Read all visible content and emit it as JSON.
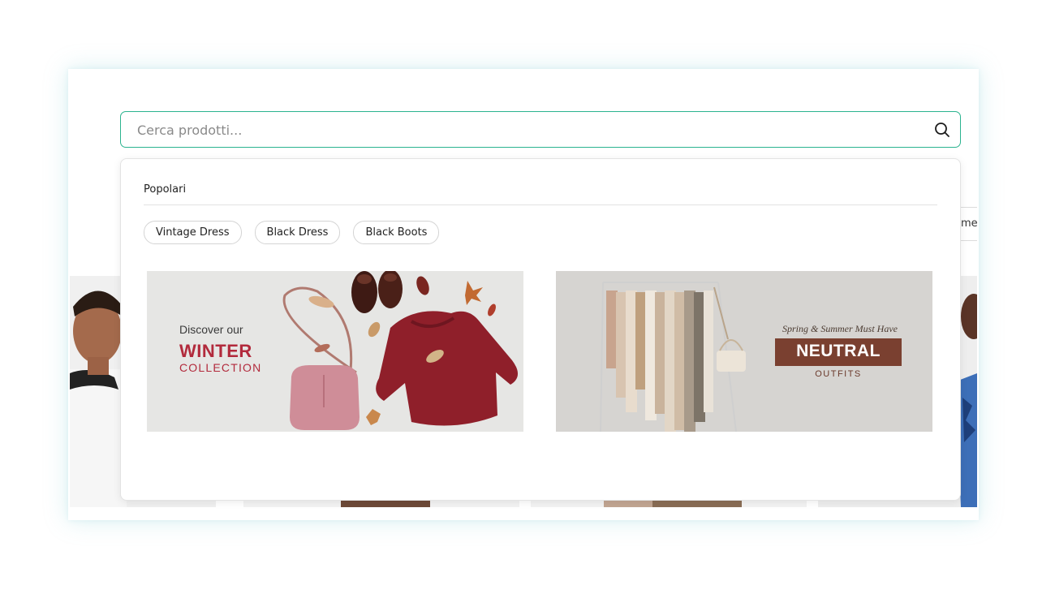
{
  "search": {
    "placeholder": "Cerca prodotti..."
  },
  "background": {
    "menu_fragment": "me"
  },
  "popular": {
    "title": "Popolari",
    "chips": [
      "Vintage Dress",
      "Black Dress",
      "Black Boots"
    ]
  },
  "banners": {
    "winter": {
      "line1": "Discover our",
      "line2": "WINTER",
      "line3": "COLLECTION"
    },
    "neutral": {
      "line1": "Spring & Summer Must Have",
      "line2": "NEUTRAL",
      "line3": "OUTFITS"
    }
  },
  "colors": {
    "search_border": "#2bb38f",
    "winter_accent": "#b22a3c",
    "neutral_box": "#7a4030"
  },
  "icons": {
    "search": "search-icon"
  }
}
